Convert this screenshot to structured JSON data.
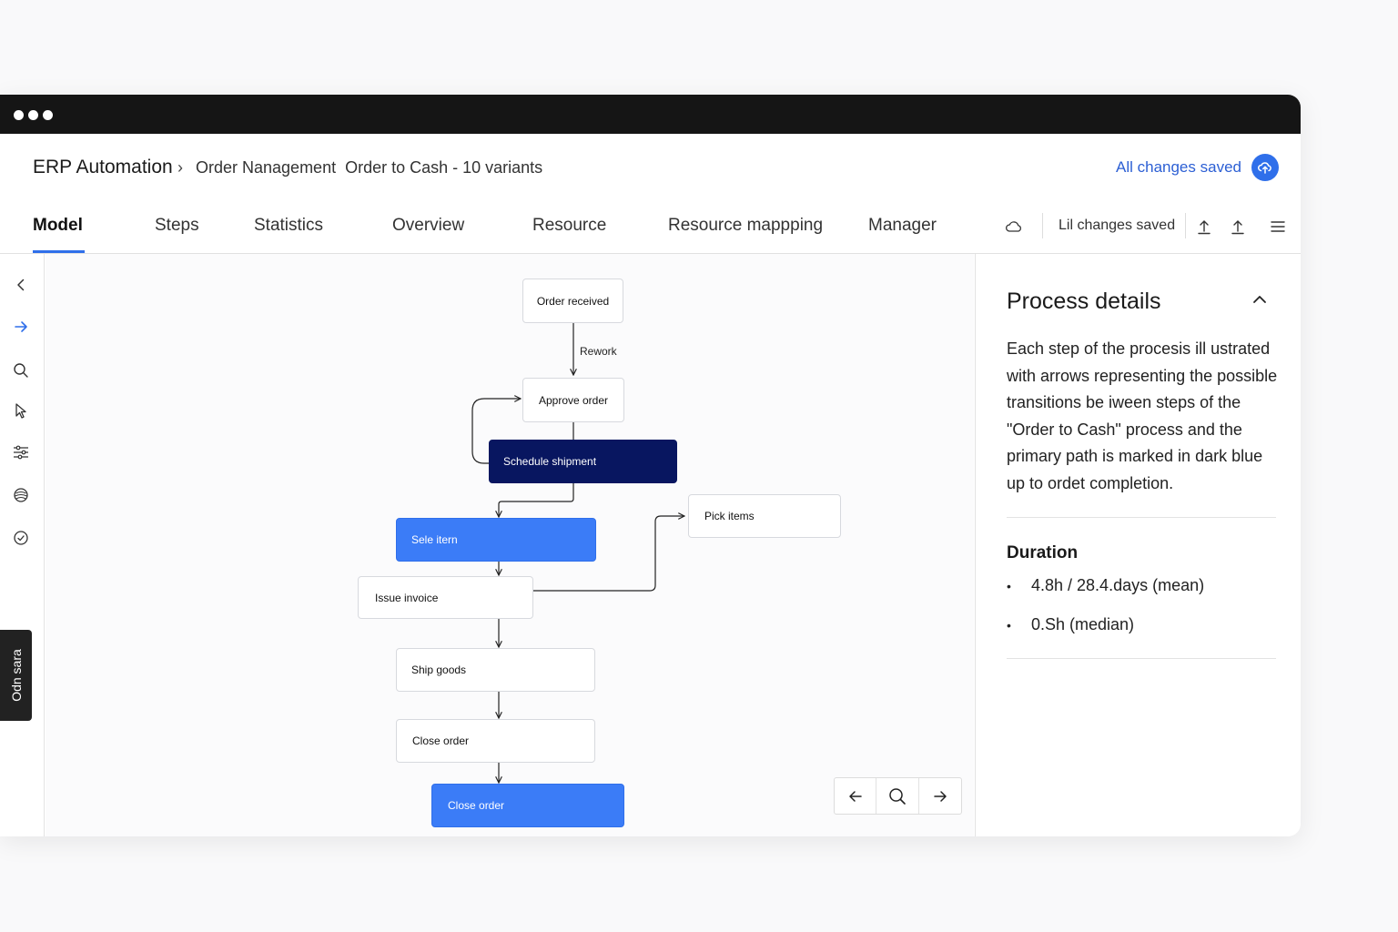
{
  "header": {
    "app_title": "ERP Automation",
    "breadcrumb": "Order Nanagement  Order to Cash - 10 variants",
    "save_status": "All changes saved"
  },
  "tabs": [
    {
      "label": "Model",
      "active": true
    },
    {
      "label": "Steps"
    },
    {
      "label": "Statistics"
    },
    {
      "label": "Overview"
    },
    {
      "label": "Resource"
    },
    {
      "label": "Resource mappping"
    },
    {
      "label": "Manager"
    }
  ],
  "toolbar": {
    "status": "Lil changes saved",
    "icons": [
      "cloud-icon",
      "upload-icon",
      "share-icon",
      "menu-icon"
    ]
  },
  "sidebar": {
    "icons": [
      "chevron-left-icon",
      "arrow-right-icon",
      "search-icon",
      "cursor-icon",
      "sliders-icon",
      "layers-icon",
      "check-circle-icon"
    ],
    "vertical_tab": "Odn sara"
  },
  "diagram": {
    "nodes": {
      "order_received": "Order received",
      "approve_order": "Approve order",
      "schedule_shipment": "Schedule shipment",
      "pick_items": "Pick items",
      "sele_item": "Sele itern",
      "issue_invoice": "Issue invoice",
      "ship_goods": "Ship goods",
      "close_order": "Close order",
      "close_order_final": "Close order"
    },
    "edge_labels": {
      "rework": "Rework"
    },
    "colors": {
      "primary_path": "#081660",
      "highlight": "#3b7cf7",
      "accent": "#2f6fea"
    }
  },
  "zoom_controls": [
    "arrow-left-icon",
    "search-icon",
    "arrow-right-icon"
  ],
  "panel": {
    "title": "Process details",
    "description": "Each step of the procesis ill ustrated with arrows representing the possible transitions be iween steps of the \"Order to Cash\" process and the primary path is marked in dark blue up to ordet completion.",
    "duration_title": "Duration",
    "duration_items": [
      "4.8h / 28.4.days (mean)",
      "0.Sh (median)"
    ]
  }
}
